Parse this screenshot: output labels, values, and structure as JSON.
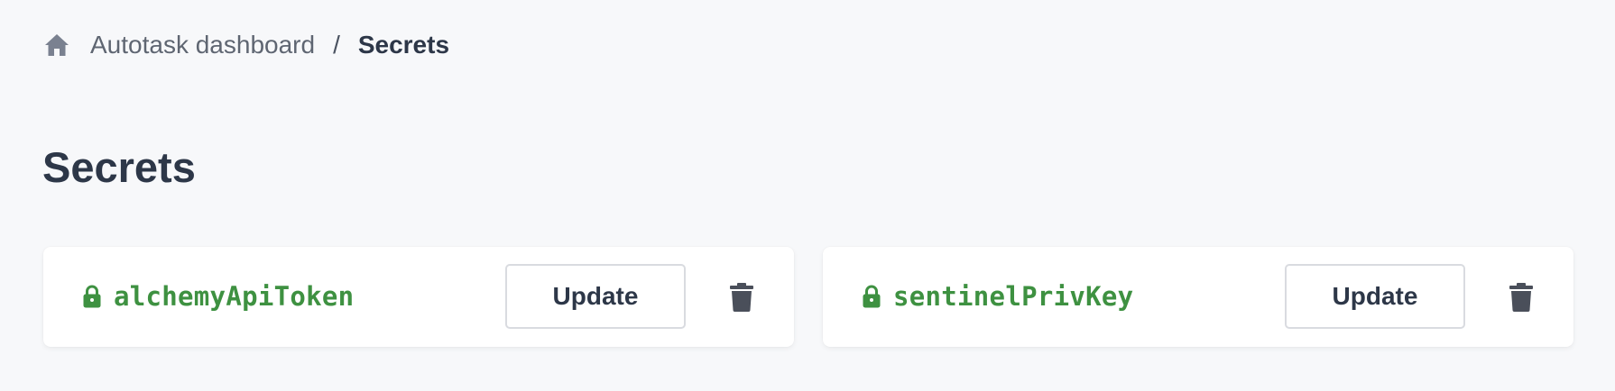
{
  "breadcrumb": {
    "home_icon": "home-icon",
    "parent": "Autotask dashboard",
    "separator": "/",
    "current": "Secrets"
  },
  "page": {
    "title": "Secrets"
  },
  "secrets": [
    {
      "icon": "lock-icon",
      "name": "alchemyApiToken",
      "update_label": "Update",
      "delete_icon": "trash-icon"
    },
    {
      "icon": "lock-icon",
      "name": "sentinelPrivKey",
      "update_label": "Update",
      "delete_icon": "trash-icon"
    }
  ],
  "colors": {
    "background": "#f7f8fa",
    "secret_name": "#3e9141",
    "text_dark": "#2d3748",
    "text_muted": "#5f6672",
    "icon_gray": "#7a8190",
    "trash": "#4a4f5a"
  }
}
